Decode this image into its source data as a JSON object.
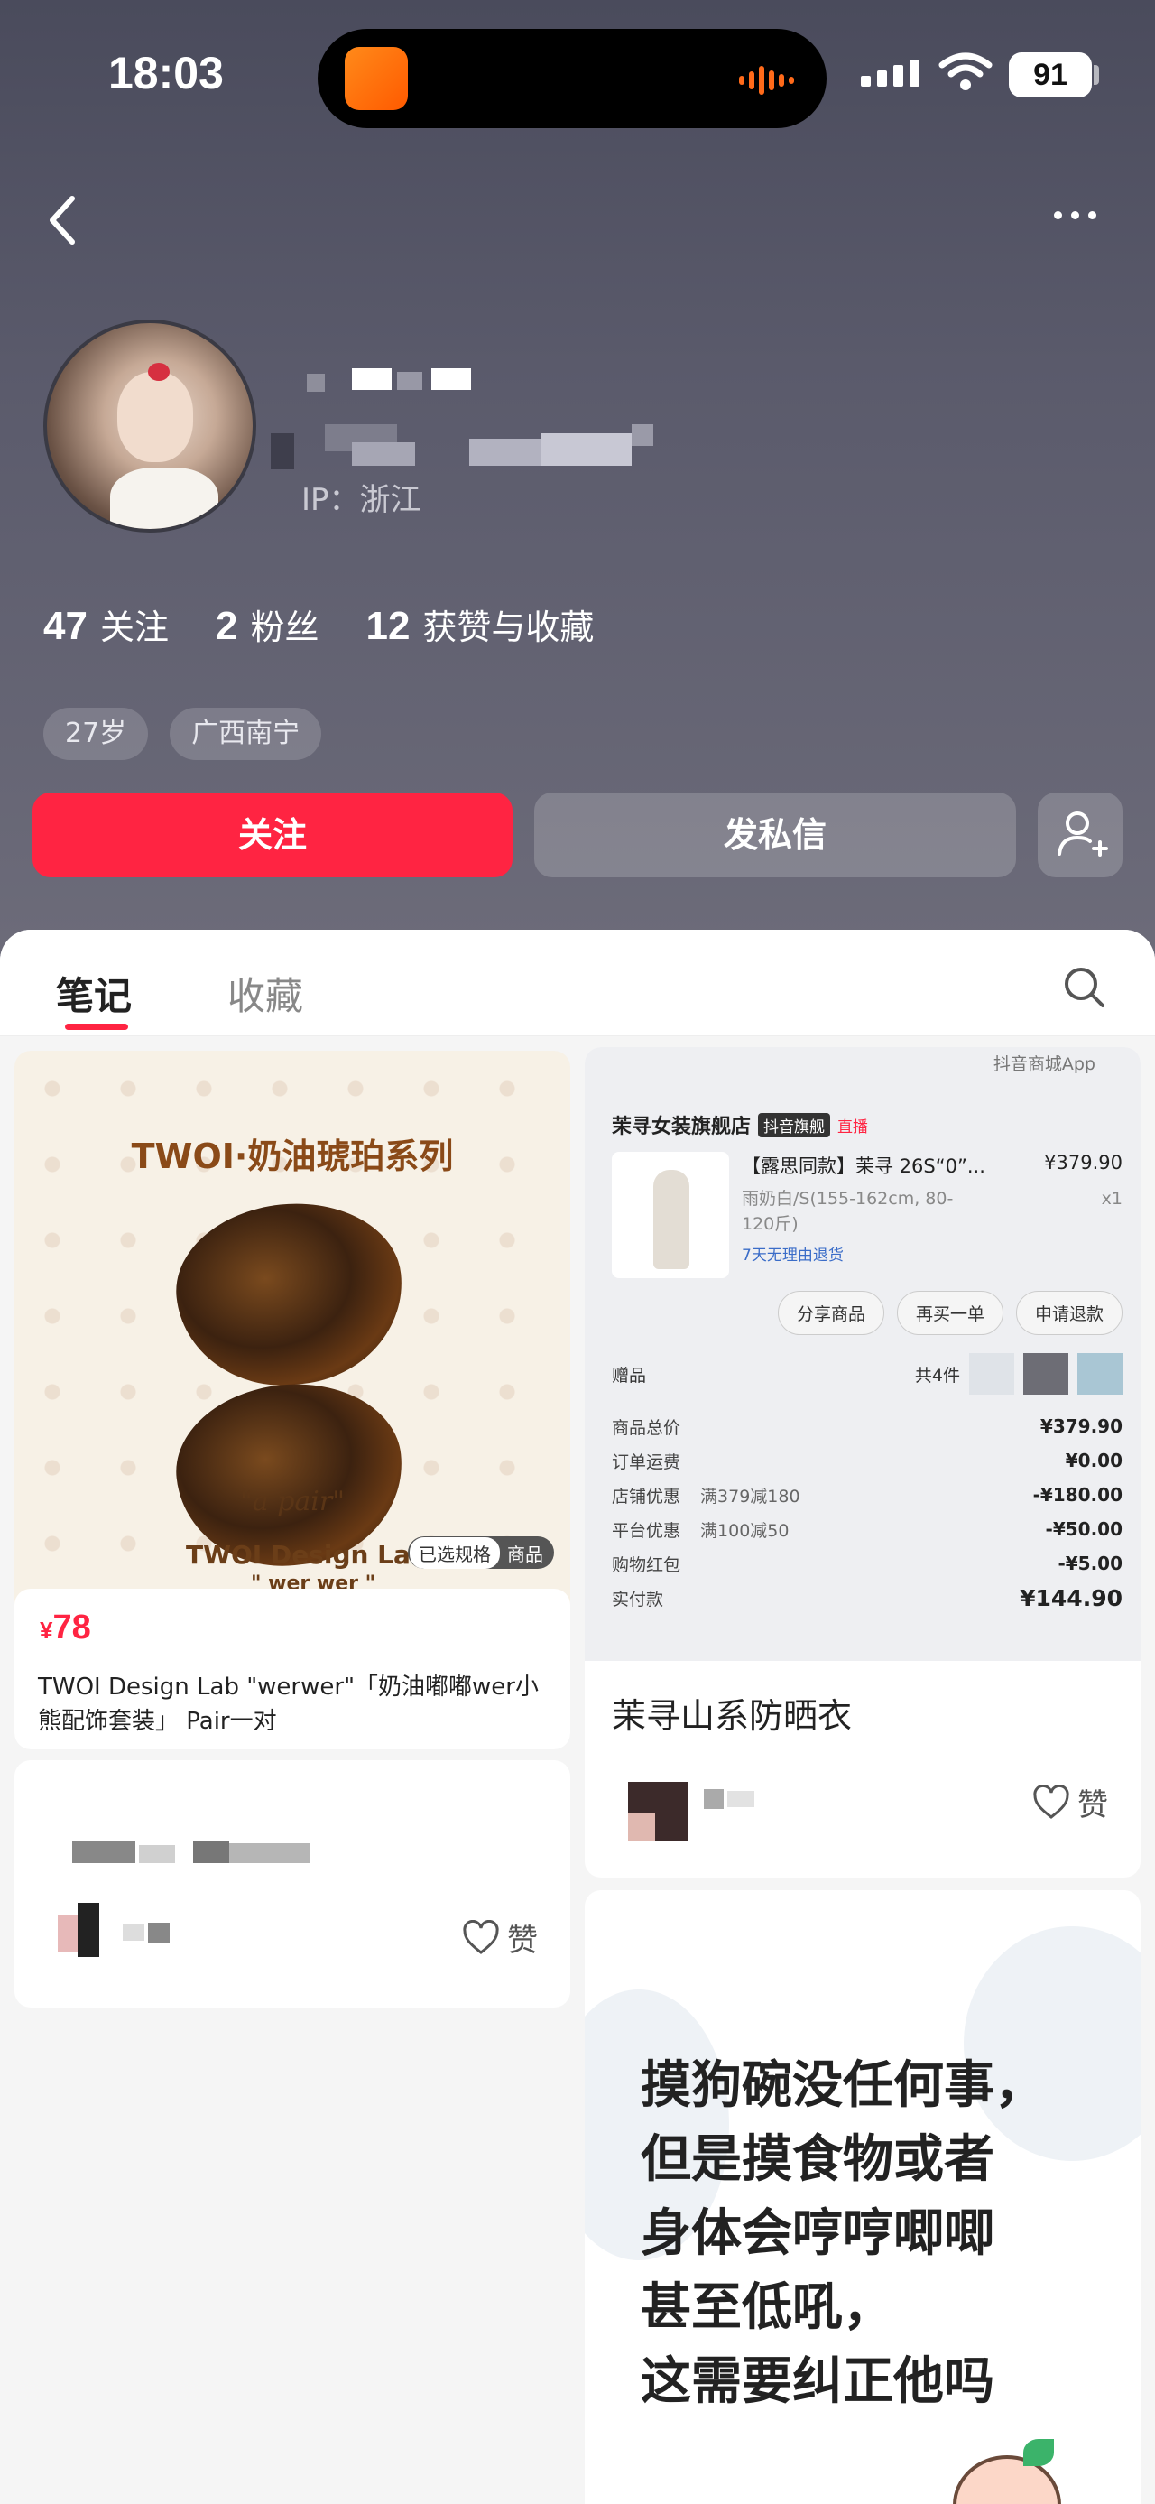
{
  "status_bar": {
    "time": "18:03",
    "battery": "91"
  },
  "profile": {
    "ip_location": "IP：浙江"
  },
  "stats": [
    {
      "num": "47",
      "label": "关注"
    },
    {
      "num": "2",
      "label": "粉丝"
    },
    {
      "num": "12",
      "label": "获赞与收藏"
    }
  ],
  "tags": [
    "27岁",
    "广西南宁"
  ],
  "actions": {
    "follow": "关注",
    "message": "发私信"
  },
  "tabs": {
    "notes": "笔记",
    "collect": "收藏"
  },
  "cards": {
    "product": {
      "image_title": "TWOI·奶油琥珀系列",
      "image_pair": "\"a pair\"",
      "image_brand": "TWOI Design Lab",
      "image_brand_sub": "\" wer wer \"",
      "chip_selected": "已选规格",
      "chip_product": "商品",
      "price_symbol": "¥",
      "price": "78",
      "description": "TWOI Design Lab \"werwer\"「奶油嘟嘟wer小熊配饰套装」 Pair一对",
      "like_label": "赞"
    },
    "order": {
      "app": "抖音商城App",
      "store": "茉寻女装旗舰店",
      "store_badge": "抖音旗舰",
      "live": "直播",
      "item_name": "【露思同款】茉寻 26S“0”...",
      "item_price": "¥379.90",
      "item_spec": "雨奶白/S(155-162cm, 80-120斤)",
      "item_qty": "x1",
      "return_policy": "7天无理由退货",
      "btn_share": "分享商品",
      "btn_rebuy": "再买一单",
      "btn_refund": "申请退款",
      "gift_label": "赠品",
      "gift_count": "共4件",
      "rows": [
        {
          "label": "商品总价",
          "note": "",
          "value": "¥379.90"
        },
        {
          "label": "订单运费",
          "note": "",
          "value": "¥0.00"
        },
        {
          "label": "店铺优惠",
          "note": "满379减180",
          "value": "-¥180.00"
        },
        {
          "label": "平台优惠",
          "note": "满100减50",
          "value": "-¥50.00"
        },
        {
          "label": "购物红包",
          "note": "",
          "value": "-¥5.00"
        },
        {
          "label": "实付款",
          "note": "",
          "value": "¥144.90"
        }
      ],
      "title": "茉寻山系防晒衣",
      "like_label": "赞"
    },
    "text_note": {
      "lines": [
        "摸狗碗没任何事，",
        "但是摸食物或者",
        "身体会哼哼唧唧",
        "甚至低吼，",
        "这需要纠正他吗"
      ]
    },
    "second_left": {
      "like_label": "赞"
    }
  },
  "colors": {
    "accent": "#ff2442",
    "header_bg": "#555565"
  },
  "icons": [
    "back-icon",
    "more-icon",
    "add-user-icon",
    "search-icon",
    "heart-icon"
  ]
}
